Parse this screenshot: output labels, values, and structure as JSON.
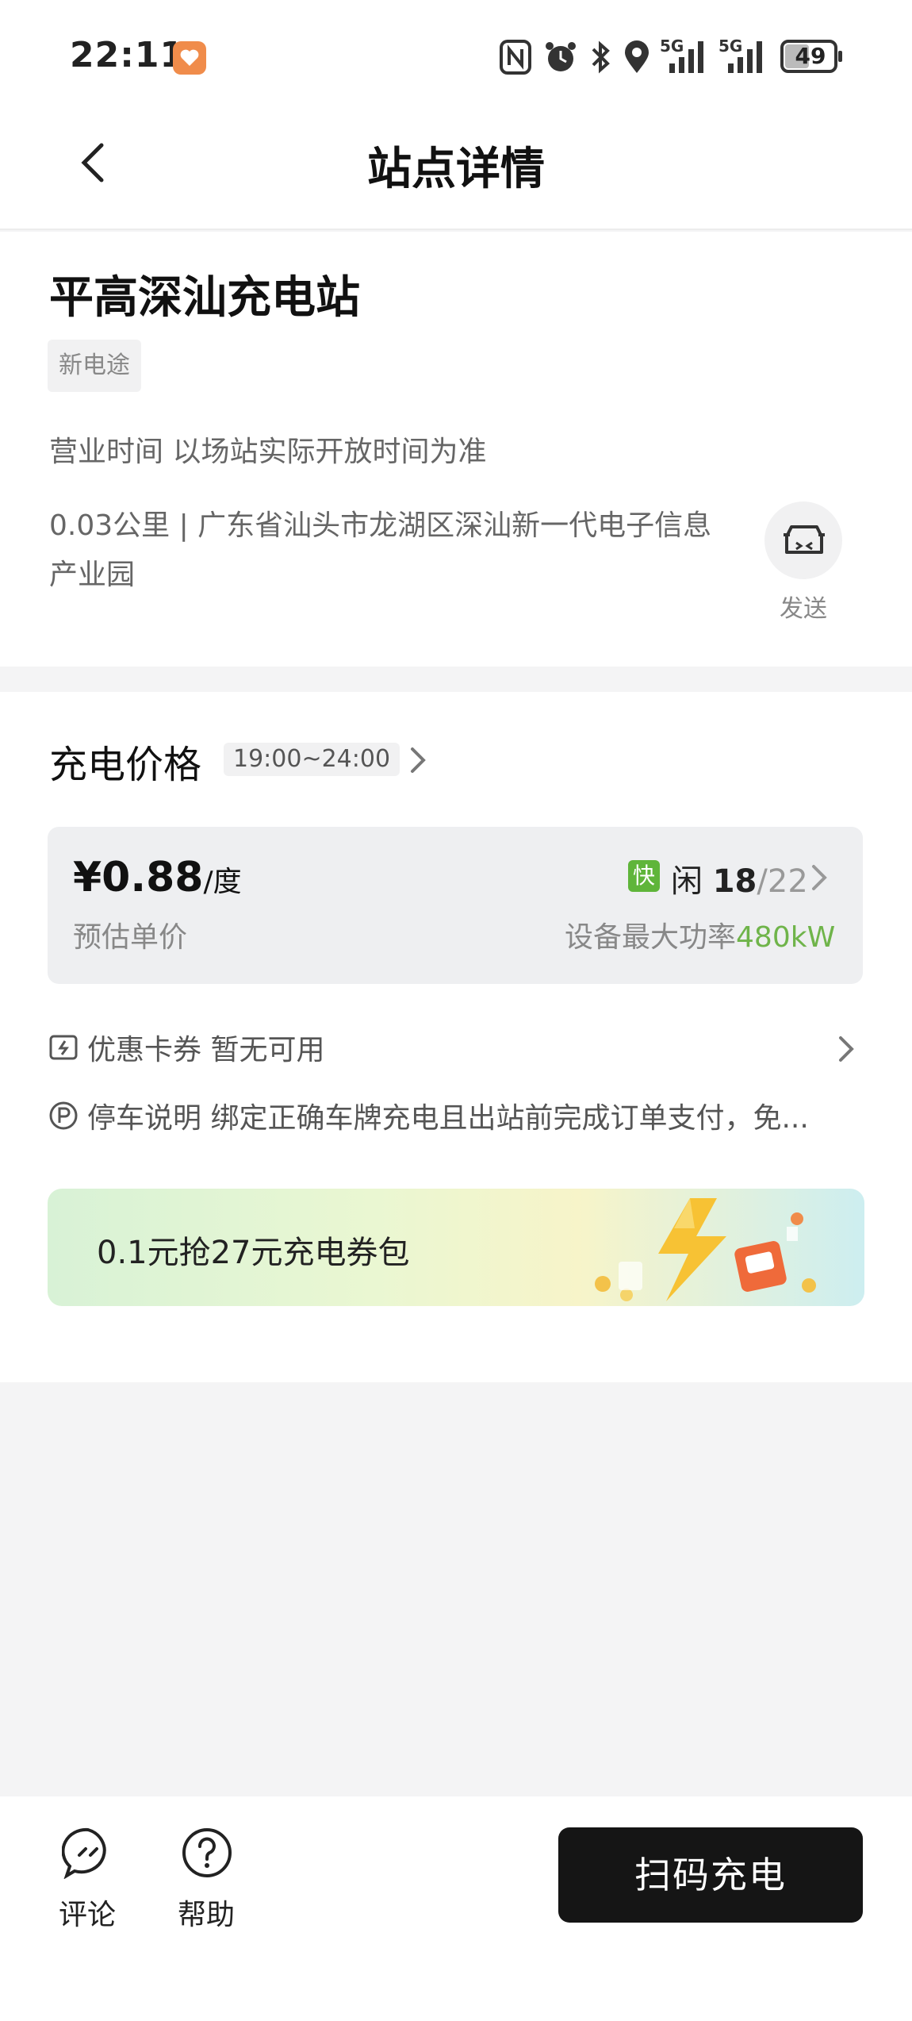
{
  "status_bar": {
    "time": "22:11",
    "battery": "49",
    "network_labels": [
      "5G",
      "5G"
    ],
    "icons": [
      "heart-app-icon",
      "nfc-icon",
      "alarm-icon",
      "bluetooth-icon",
      "location-icon",
      "signal-icon",
      "signal-icon",
      "battery-icon"
    ]
  },
  "header": {
    "title": "站点详情"
  },
  "station": {
    "name": "平高深汕充电站",
    "operator_tag": "新电途",
    "hours": "营业时间 以场站实际开放时间为准",
    "address": "0.03公里 | 广东省汕头市龙湖区深汕新一代电子信息产业园",
    "send_label": "发送"
  },
  "pricing": {
    "section_title": "充电价格",
    "time_range": "19:00~24:00",
    "price": "¥0.88",
    "unit": "/度",
    "price_caption": "预估单价",
    "fast_label": "快",
    "idle_label": "闲",
    "idle_count": "18",
    "total_count": "/22",
    "power_label": "设备最大功率",
    "power_value": "480kW"
  },
  "coupons": {
    "label": "优惠卡券 暂无可用"
  },
  "parking": {
    "text": "停车说明 绑定正确车牌充电且出站前完成订单支付，免..."
  },
  "banner": {
    "text": "0.1元抢27元充电券包"
  },
  "bottom_bar": {
    "comment_label": "评论",
    "help_label": "帮助",
    "scan_label": "扫码充电"
  },
  "colors": {
    "accent_green": "#6fb44a",
    "fast_badge": "#5fb53a",
    "primary_button": "#151515"
  }
}
